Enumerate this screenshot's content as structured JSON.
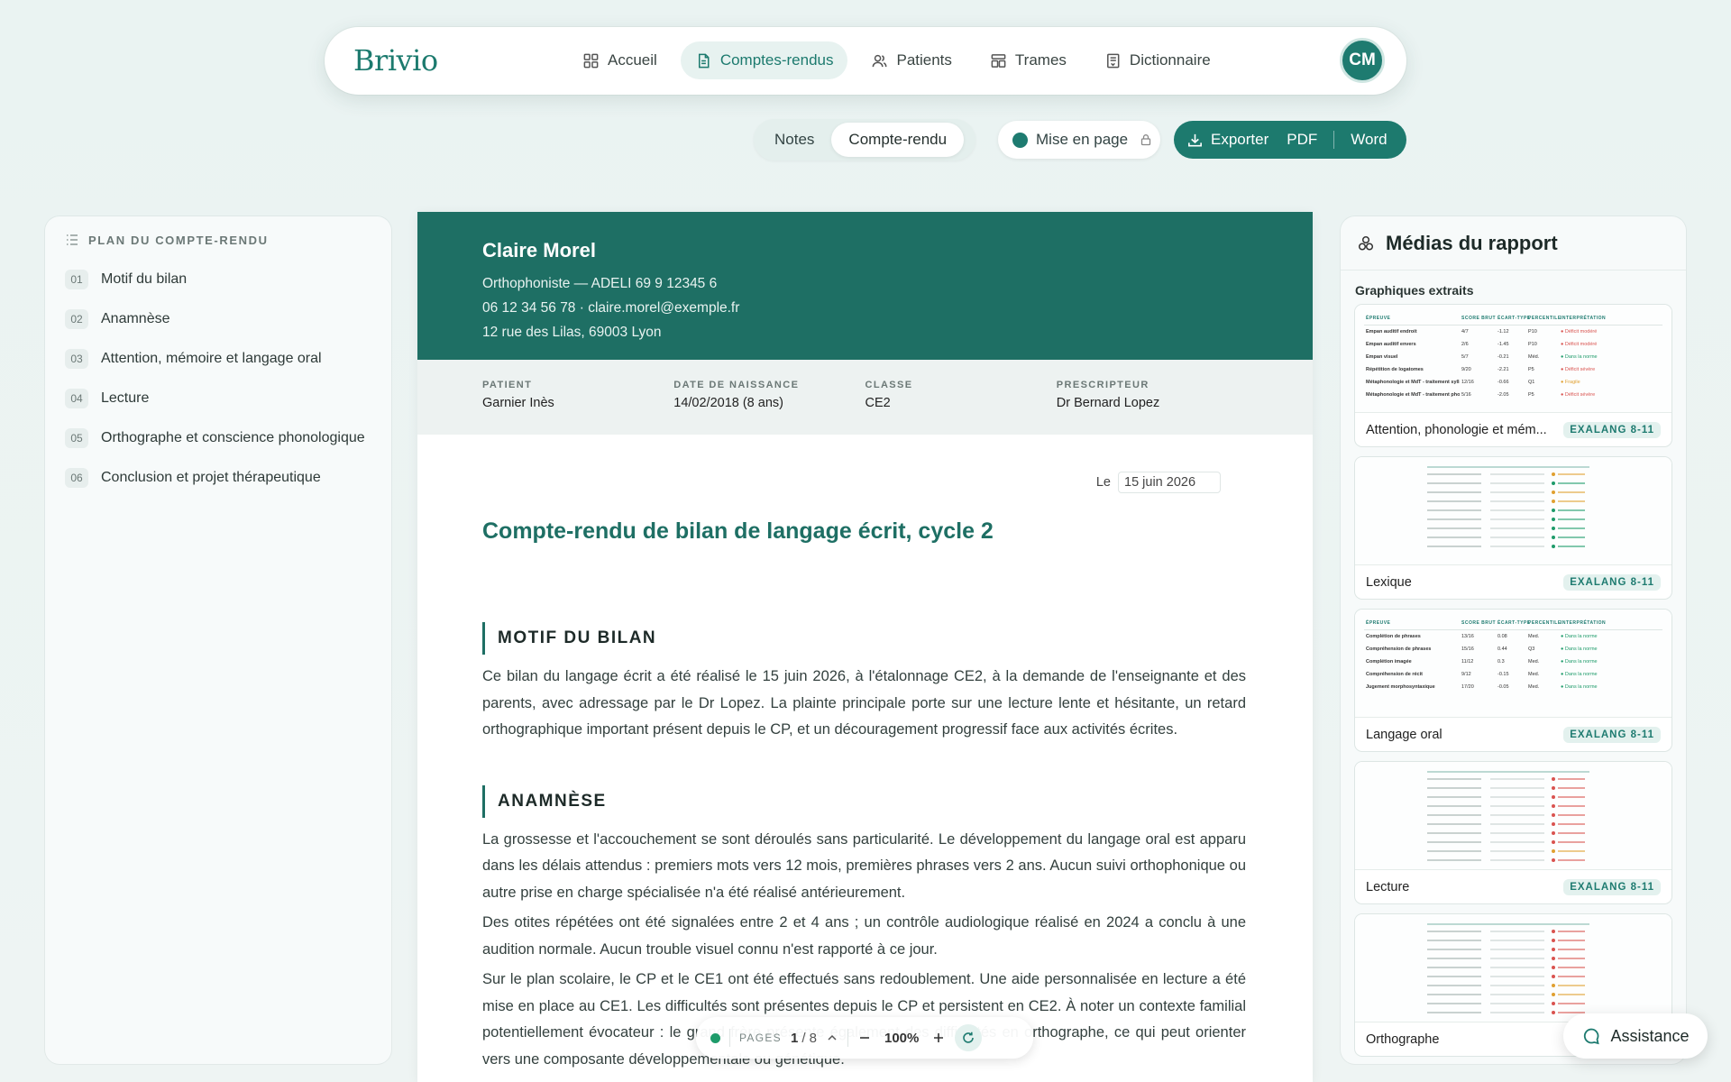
{
  "brand": "Brivio",
  "nav": [
    {
      "label": "Accueil",
      "icon": "grid-icon",
      "active": false
    },
    {
      "label": "Comptes-rendus",
      "icon": "document-icon",
      "active": true
    },
    {
      "label": "Patients",
      "icon": "users-icon",
      "active": false
    },
    {
      "label": "Trames",
      "icon": "template-icon",
      "active": false
    },
    {
      "label": "Dictionnaire",
      "icon": "book-icon",
      "active": false
    }
  ],
  "user": {
    "initials": "CM"
  },
  "toolbar": {
    "notes_label": "Notes",
    "report_label": "Compte-rendu",
    "layout_label": "Mise en page",
    "export_label": "Exporter",
    "pdf_label": "PDF",
    "word_label": "Word"
  },
  "plan": {
    "title": "PLAN DU COMPTE-RENDU",
    "items": [
      {
        "num": "01",
        "label": "Motif du bilan"
      },
      {
        "num": "02",
        "label": "Anamnèse"
      },
      {
        "num": "03",
        "label": "Attention, mémoire et langage oral"
      },
      {
        "num": "04",
        "label": "Lecture"
      },
      {
        "num": "05",
        "label": "Orthographe et conscience phonologique"
      },
      {
        "num": "06",
        "label": "Conclusion et projet thérapeutique"
      }
    ]
  },
  "doc": {
    "author": "Claire Morel",
    "role": "Orthophoniste — ADELI 69 9 12345 6",
    "contact": "06 12 34 56 78 · claire.morel@exemple.fr",
    "address": "12 rue des Lilas, 69003 Lyon",
    "patient_fields": [
      {
        "label": "PATIENT",
        "value": "Garnier Inès"
      },
      {
        "label": "DATE DE NAISSANCE",
        "value": "14/02/2018 (8 ans)"
      },
      {
        "label": "CLASSE",
        "value": "CE2"
      },
      {
        "label": "PRESCRIPTEUR",
        "value": "Dr Bernard Lopez"
      }
    ],
    "date_prefix": "Le",
    "date_value": "15 juin 2026",
    "title": "Compte-rendu de bilan de langage écrit, cycle 2",
    "sec1_title": "MOTIF DU BILAN",
    "sec1_p1": "Ce bilan du langage écrit a été réalisé le 15 juin 2026, à l'étalonnage CE2, à la demande de l'enseignante et des parents, avec adressage par le Dr Lopez. La plainte principale porte sur une lecture lente et hésitante, un retard orthographique important présent depuis le CP, et un découragement progressif face aux activités écrites.",
    "sec2_title": "ANAMNÈSE",
    "sec2_p1": "La grossesse et l'accouchement se sont déroulés sans particularité. Le développement du langage oral est apparu dans les délais attendus : premiers mots vers 12 mois, premières phrases vers 2 ans. Aucun suivi orthophonique ou autre prise en charge spécialisée n'a été réalisé antérieurement.",
    "sec2_p2": "Des otites répétées ont été signalées entre 2 et 4 ans ; un contrôle audiologique réalisé en 2024 a conclu à une audition normale. Aucun trouble visuel connu n'est rapporté à ce jour.",
    "sec2_p3": "Sur le plan scolaire, le CP et le CE1 ont été effectués sans redoublement. Une aide personnalisée en lecture a été mise en place au CE1. Les difficultés sont présentes depuis le CP et persistent en CE2. À noter un contexte familial potentiellement évocateur : le grand frère présente également des difficultés en orthographe, ce qui peut orienter vers une composante développementale ou génétique."
  },
  "pagebar": {
    "pages_label": "PAGES",
    "current": "1",
    "total": "/ 8",
    "zoom": "100%"
  },
  "media": {
    "title": "Médias du rapport",
    "subtitle": "Graphiques extraits",
    "cards": [
      {
        "title": "Attention, phonologie et mém...",
        "badge": "EXALANG 8-11"
      },
      {
        "title": "Lexique",
        "badge": "EXALANG 8-11"
      },
      {
        "title": "Langage oral",
        "badge": "EXALANG 8-11"
      },
      {
        "title": "Lecture",
        "badge": "EXALANG 8-11"
      },
      {
        "title": "Orthographe",
        "badge": ""
      }
    ],
    "thumb1": {
      "headers": [
        "ÉPREUVE",
        "SCORE BRUT",
        "ÉCART-TYPE",
        "PERCENTILE",
        "INTERPRÉTATION"
      ],
      "rows": [
        [
          "Empan auditif endroit",
          "4/7",
          "-1.12",
          "P10",
          "Déficit modéré"
        ],
        [
          "Empan auditif envers",
          "2/6",
          "-1.45",
          "P10",
          "Déficit modéré"
        ],
        [
          "Empan visuel",
          "5/7",
          "-0.21",
          "Méd.",
          "Dans la norme"
        ],
        [
          "Répétition de logatomes",
          "9/20",
          "-2.21",
          "P5",
          "Déficit sévère"
        ],
        [
          "Métaphonologie et MdT - traitement syllabique",
          "12/16",
          "-0.66",
          "Q1",
          "Fragile"
        ],
        [
          "Métaphonologie et MdT - traitement phonémique",
          "5/16",
          "-2.05",
          "P5",
          "Déficit sévère"
        ]
      ]
    },
    "thumb3": {
      "headers": [
        "ÉPREUVE",
        "SCORE BRUT",
        "ÉCART-TYPE",
        "PERCENTILE",
        "INTERPRÉTATION"
      ],
      "rows": [
        [
          "Complétion de phrases",
          "13/16",
          "0.08",
          "Med.",
          "Dans la norme"
        ],
        [
          "Compréhension de phrases",
          "15/16",
          "0.44",
          "Q3",
          "Dans la norme"
        ],
        [
          "Complétion imagée",
          "11/12",
          "0.3",
          "Med.",
          "Dans la norme"
        ],
        [
          "Compréhension de récit",
          "9/12",
          "-0.15",
          "Med.",
          "Dans la norme"
        ],
        [
          "Jugement morphosyntaxique",
          "17/20",
          "-0.05",
          "Med.",
          "Dans la norme"
        ]
      ]
    },
    "colors": {
      "deficit": "#d9534f",
      "fragile": "#e0a030",
      "norme": "#1e9b6a"
    }
  },
  "assist_label": "Assistance"
}
